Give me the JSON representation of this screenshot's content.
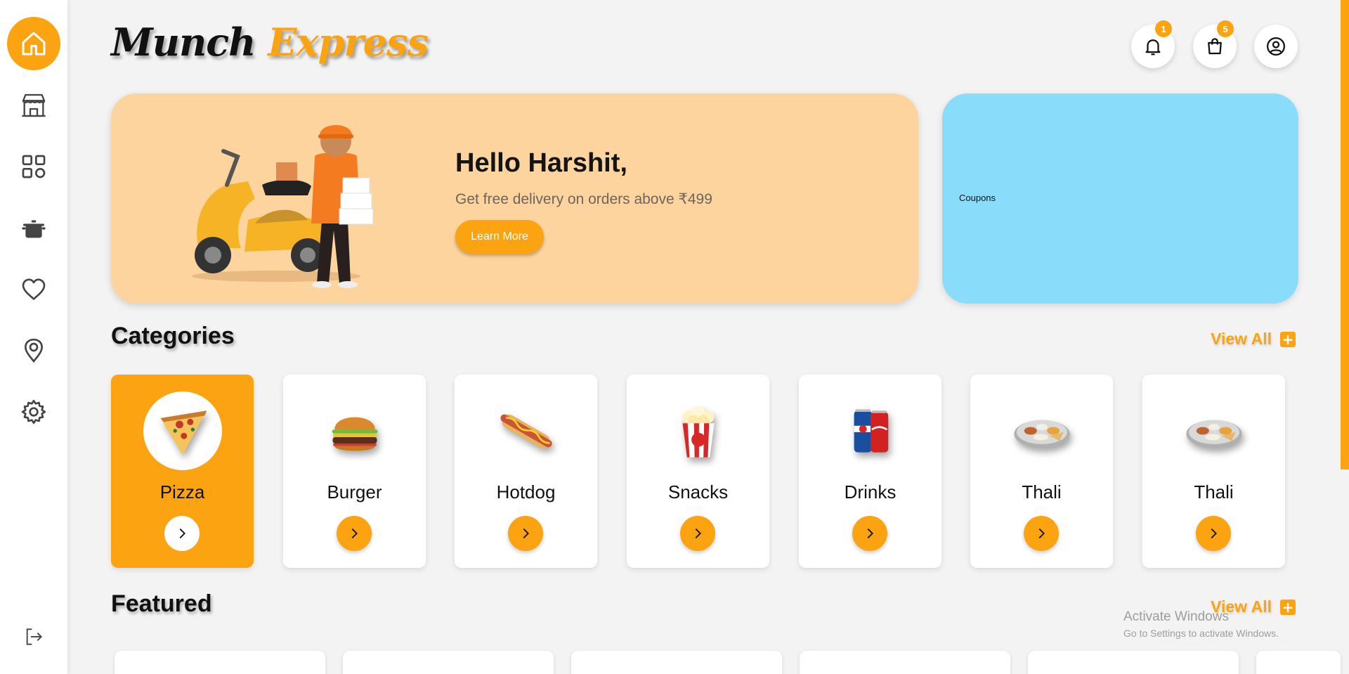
{
  "brand": {
    "name_part1": "Munch",
    "name_part2": "Express"
  },
  "sidebar": {
    "items": [
      {
        "icon": "home-icon",
        "active": true
      },
      {
        "icon": "store-icon",
        "active": false
      },
      {
        "icon": "grid-icon",
        "active": false
      },
      {
        "icon": "cooking-pot-icon",
        "active": false
      },
      {
        "icon": "heart-icon",
        "active": false
      },
      {
        "icon": "location-icon",
        "active": false
      },
      {
        "icon": "gear-icon",
        "active": false
      }
    ],
    "logout_icon": "logout-icon"
  },
  "header": {
    "notifications_count": "1",
    "cart_count": "5",
    "profile_icon": "user-icon"
  },
  "hero": {
    "title": "Hello Harshit,",
    "subtitle": "Get free delivery on orders above ₹499",
    "button": "Learn More"
  },
  "coupons": {
    "label": "Coupons"
  },
  "categories": {
    "title": "Categories",
    "view_all": "View All",
    "items": [
      {
        "name": "Pizza",
        "icon": "pizza-icon"
      },
      {
        "name": "Burger",
        "icon": "burger-icon"
      },
      {
        "name": "Hotdog",
        "icon": "hotdog-icon"
      },
      {
        "name": "Snacks",
        "icon": "popcorn-icon"
      },
      {
        "name": "Drinks",
        "icon": "soda-cans-icon"
      },
      {
        "name": "Thali",
        "icon": "thali-icon"
      },
      {
        "name": "Thali",
        "icon": "thali-icon"
      }
    ]
  },
  "featured": {
    "title": "Featured",
    "view_all": "View All"
  },
  "watermark": {
    "line1": "Activate Windows",
    "line2": "Go to Settings to activate Windows."
  },
  "colors": {
    "accent": "#fca311",
    "hero_bg": "#fdd39e",
    "coupons_bg": "#8adcfb",
    "page_bg": "#f3f3f3"
  }
}
